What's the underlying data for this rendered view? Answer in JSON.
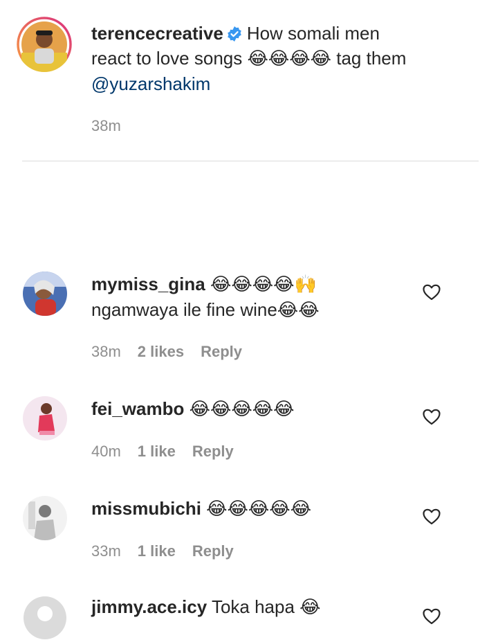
{
  "post": {
    "username": "terencecreative",
    "caption_line1": "How somali men",
    "caption_line2_text": "react to love songs",
    "caption_line2_emoji": "😂😂😂😂",
    "caption_line2_tail": "tag them",
    "mention": "@yuzarshakim",
    "time": "38m"
  },
  "comments": [
    {
      "username": "mymiss_gina",
      "text_line1": "😂😂😂😂🙌",
      "text_line2": "ngamwaya ile fine wine😂😂",
      "time": "38m",
      "likes": "2 likes",
      "reply": "Reply"
    },
    {
      "username": "fei_wambo",
      "text_line1": "😂😂😂😂😂",
      "time": "40m",
      "likes": "1 like",
      "reply": "Reply"
    },
    {
      "username": "missmubichi",
      "text_line1": "😂😂😂😂😂",
      "time": "33m",
      "likes": "1 like",
      "reply": "Reply"
    },
    {
      "username": "jimmy.ace.icy",
      "text_line1": "Toka hapa 😂"
    }
  ],
  "icons": {
    "verified_color": "#3897f0",
    "heart": "heart-outline-icon"
  },
  "colors": {
    "muted": "#8e8e8e",
    "mention": "#00376b",
    "story_ring": [
      "#f9a03f",
      "#d92e7f"
    ]
  }
}
